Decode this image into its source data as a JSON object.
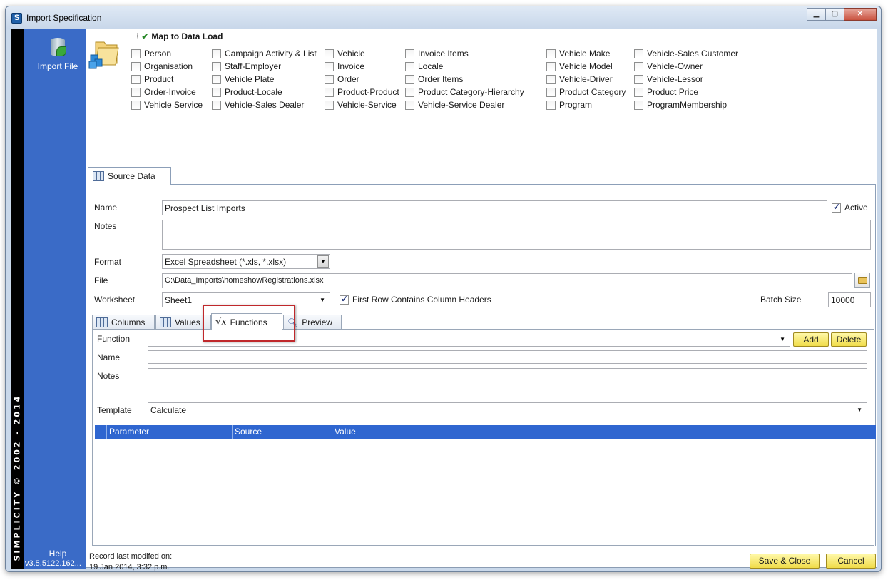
{
  "window": {
    "title": "Import Specification",
    "app_icon_letter": "S",
    "buttons": [
      "minimize",
      "maximize",
      "close"
    ]
  },
  "sidebar": {
    "import_file_label": "Import File",
    "brand_text": "SIMPLICITY © 2002 - 2014",
    "help_label": "Help",
    "version": "v3.5.5122.162..."
  },
  "map": {
    "title": "Map to Data Load",
    "columns": [
      [
        {
          "label": "Person",
          "checked": false
        },
        {
          "label": "Organisation",
          "checked": false
        },
        {
          "label": "Product",
          "checked": false
        },
        {
          "label": "Order-Invoice",
          "checked": false
        },
        {
          "label": "Vehicle Service",
          "checked": false
        }
      ],
      [
        {
          "label": "Campaign Activity & List",
          "checked": false
        },
        {
          "label": "Staff-Employer",
          "checked": false
        },
        {
          "label": "Vehicle Plate",
          "checked": false
        },
        {
          "label": "Product-Locale",
          "checked": false
        },
        {
          "label": "Vehicle-Sales Dealer",
          "checked": false
        }
      ],
      [
        {
          "label": "Vehicle",
          "checked": false
        },
        {
          "label": "Invoice",
          "checked": false
        },
        {
          "label": "Order",
          "checked": false
        },
        {
          "label": "Product-Product",
          "checked": false
        },
        {
          "label": "Vehicle-Service",
          "checked": false
        }
      ],
      [
        {
          "label": "Invoice Items",
          "checked": false
        },
        {
          "label": "Locale",
          "checked": false
        },
        {
          "label": "Order Items",
          "checked": false
        },
        {
          "label": "Product Category-Hierarchy",
          "checked": false
        },
        {
          "label": "Vehicle-Service Dealer",
          "checked": false
        }
      ],
      [
        {
          "label": "Vehicle Make",
          "checked": false
        },
        {
          "label": "Vehicle Model",
          "checked": false
        },
        {
          "label": "Vehicle-Driver",
          "checked": false
        },
        {
          "label": "Product Category",
          "checked": false
        },
        {
          "label": "Program",
          "checked": false
        }
      ],
      [
        {
          "label": "Vehicle-Sales Customer",
          "checked": false
        },
        {
          "label": "Vehicle-Owner",
          "checked": false
        },
        {
          "label": "Vehicle-Lessor",
          "checked": false
        },
        {
          "label": "Product Price",
          "checked": false
        },
        {
          "label": "ProgramMembership",
          "checked": false
        }
      ]
    ]
  },
  "source": {
    "tab_label": "Source Data",
    "name_label": "Name",
    "name_value": "Prospect List Imports",
    "active_label": "Active",
    "active_checked": true,
    "notes_label": "Notes",
    "notes_value": "",
    "format_label": "Format",
    "format_value": "Excel Spreadsheet (*.xls, *.xlsx)",
    "file_label": "File",
    "file_value": "C:\\Data_Imports\\homeshowRegistrations.xlsx",
    "worksheet_label": "Worksheet",
    "worksheet_value": "Sheet1",
    "first_row_label": "First Row Contains Column Headers",
    "first_row_checked": true,
    "batch_label": "Batch Size",
    "batch_value": "10000"
  },
  "tabs": {
    "columns": "Columns",
    "values": "Values",
    "functions": "Functions",
    "preview": "Preview",
    "active": "functions"
  },
  "functions": {
    "function_label": "Function",
    "function_value": "",
    "add_label": "Add",
    "delete_label": "Delete",
    "name_label": "Name",
    "name_value": "",
    "notes_label": "Notes",
    "notes_value": "",
    "template_label": "Template",
    "template_value": "Calculate",
    "grid_headers": [
      "Parameter",
      "Source",
      "Value"
    ],
    "grid_header_color": "#2f66d0"
  },
  "footer": {
    "record_label": "Record last modifed on:",
    "record_date": "19 Jan 2014, 3:32 p.m.",
    "save_label": "Save & Close",
    "cancel_label": "Cancel"
  }
}
